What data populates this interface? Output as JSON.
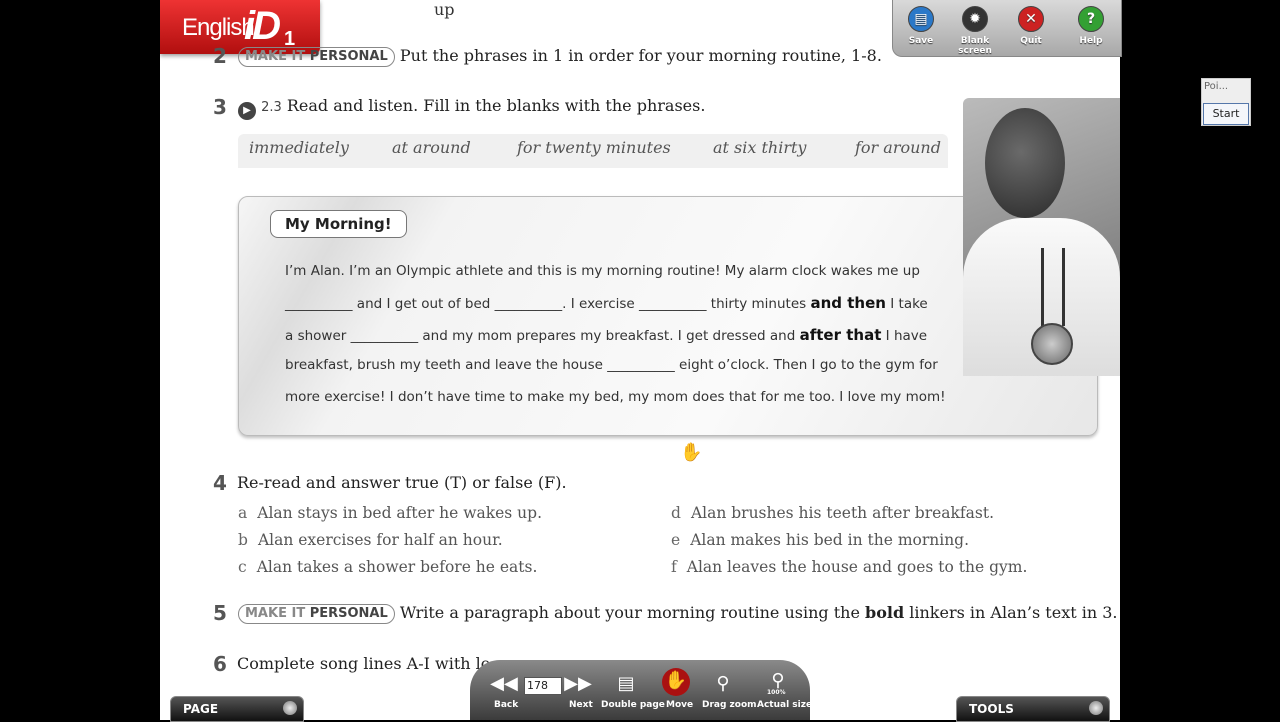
{
  "app": {
    "logo_text": "English",
    "logo_id": "iD",
    "logo_level": "1"
  },
  "top_fragment": "up",
  "toolbar": {
    "save": "Save",
    "blank_screen": "Blank screen",
    "quit": "Quit",
    "help": "Help",
    "colors": {
      "save": "#2a78c8",
      "blank": "#333333",
      "quit": "#cc2222",
      "help": "#33a033"
    }
  },
  "ex2": {
    "num": "2",
    "badge_a": "MAKE IT",
    "badge_b": "PERSONAL",
    "text": "Put the phrases in 1 in order for your morning routine, 1-8."
  },
  "ex3": {
    "num": "3",
    "audio": "2.3",
    "text": "Read and listen. Fill in the blanks with the phrases.",
    "phrases": [
      "immediately",
      "at around",
      "for twenty minutes",
      "at six thirty",
      "for around"
    ]
  },
  "story": {
    "title": "My Morning!",
    "l1": "I’m Alan. I’m an Olympic athlete and this is my morning routine! My alarm clock wakes me up",
    "l2a": "__________ and I get out of bed __________. I exercise __________ thirty minutes",
    "l2b": "and then",
    "l2c": "I take",
    "l3a": "a shower __________ and my mom prepares my breakfast. I get dressed and",
    "l3b": "after that",
    "l3c": "I have",
    "l4": "breakfast, brush my teeth and leave the house __________ eight o’clock. Then I go to the gym for",
    "l5": "more exercise! I don’t have time to make my bed, my mom does that for me too. I love my mom!"
  },
  "ex4": {
    "num": "4",
    "text": "Re-read and answer true (T) or false (F).",
    "items": [
      {
        "letter": "a",
        "text": "Alan stays in bed after he wakes up."
      },
      {
        "letter": "b",
        "text": "Alan exercises for half an hour."
      },
      {
        "letter": "c",
        "text": "Alan takes a shower before he eats."
      },
      {
        "letter": "d",
        "text": "Alan brushes his teeth after breakfast."
      },
      {
        "letter": "e",
        "text": "Alan makes his bed in the morning."
      },
      {
        "letter": "f",
        "text": "Alan leaves the house and goes to the gym."
      }
    ]
  },
  "ex5": {
    "num": "5",
    "badge_a": "MAKE IT",
    "badge_b": "PERSONAL",
    "text_a": "Write a paragraph about your morning routine using the",
    "text_bold": "bold",
    "text_b": "linkers in Alan’s text in 3."
  },
  "ex6": {
    "num": "6",
    "text": "Complete song lines A-I with lo"
  },
  "side_widget": {
    "label": "Poi...",
    "start": "Start"
  },
  "bottom": {
    "back": "Back",
    "next": "Next",
    "double_page": "Double page",
    "move": "Move",
    "drag_zoom": "Drag zoom",
    "actual_size": "Actual size",
    "page_value": "178",
    "actual_pct": "100%"
  },
  "corner": {
    "page": "PAGE",
    "tools": "TOOLS"
  }
}
